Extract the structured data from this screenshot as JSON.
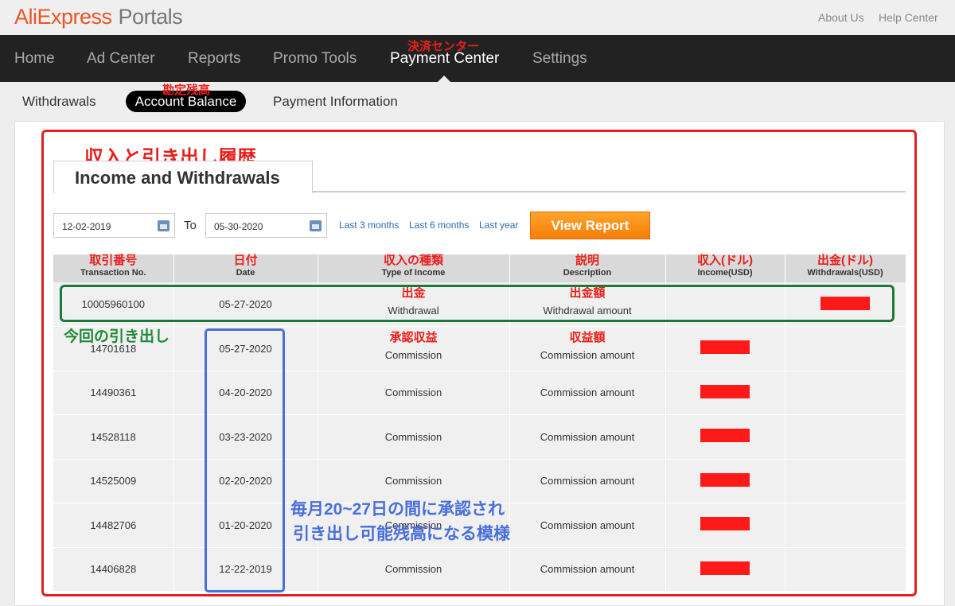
{
  "header": {
    "logo_brand": "AliExpress",
    "logo_product": "Portals",
    "links": [
      "About Us",
      "Help Center"
    ]
  },
  "nav": {
    "items": [
      "Home",
      "Ad Center",
      "Reports",
      "Promo Tools",
      "Payment Center",
      "Settings"
    ],
    "active": "Payment Center",
    "active_annotation": "決済センター"
  },
  "subnav": {
    "items": [
      "Withdrawals",
      "Account Balance",
      "Payment Information"
    ],
    "active": "Account Balance",
    "active_annotation": "勘定残高"
  },
  "section": {
    "annotation": "収入と引き出し履歴",
    "tab": "Income and Withdrawals"
  },
  "filters": {
    "from": "12-02-2019",
    "to_label": "To",
    "to": "05-30-2020",
    "quick": [
      "Last 3 months",
      "Last 6 months",
      "Last year"
    ],
    "view_report": "View Report"
  },
  "table": {
    "columns": [
      {
        "label": "Transaction No.",
        "annotation": "取引番号"
      },
      {
        "label": "Date",
        "annotation": "日付"
      },
      {
        "label": "Type of Income",
        "annotation": "収入の種類"
      },
      {
        "label": "Description",
        "annotation": "説明"
      },
      {
        "label": "Income(USD)",
        "annotation": "収入(ドル)"
      },
      {
        "label": "Withdrawals(USD)",
        "annotation": "出金(ドル)"
      }
    ],
    "rows": [
      {
        "no": "10005960100",
        "date": "05-27-2020",
        "type": "Withdrawal",
        "desc": "Withdrawal amount",
        "type_ann": "出金",
        "desc_ann": "出金額",
        "income_redacted": false,
        "withdrawal_redacted": true
      },
      {
        "no": "14701618",
        "date": "05-27-2020",
        "type": "Commission",
        "desc": "Commission amount",
        "type_ann": "承認収益",
        "desc_ann": "収益額",
        "income_redacted": true,
        "withdrawal_redacted": false
      },
      {
        "no": "14490361",
        "date": "04-20-2020",
        "type": "Commission",
        "desc": "Commission amount",
        "income_redacted": true,
        "withdrawal_redacted": false
      },
      {
        "no": "14528118",
        "date": "03-23-2020",
        "type": "Commission",
        "desc": "Commission amount",
        "income_redacted": true,
        "withdrawal_redacted": false
      },
      {
        "no": "14525009",
        "date": "02-20-2020",
        "type": "Commission",
        "desc": "Commission amount",
        "income_redacted": true,
        "withdrawal_redacted": false
      },
      {
        "no": "14482706",
        "date": "01-20-2020",
        "type": "Commission",
        "desc": "Commission amount",
        "income_redacted": true,
        "withdrawal_redacted": false
      },
      {
        "no": "14406828",
        "date": "12-22-2019",
        "type": "Commission",
        "desc": "Commission amount",
        "income_redacted": true,
        "withdrawal_redacted": false
      }
    ]
  },
  "annotations": {
    "current_withdrawal": "今回の引き出し",
    "approval_note_1": "毎月20~27日の間に承認され",
    "approval_note_2": "引き出し可能残高になる模様"
  },
  "colors": {
    "annotation_red": "#e8201c",
    "green": "#1f8a3a",
    "blue": "#4a6fd8",
    "button_orange": "#f58f1a",
    "nav_bg": "#222222",
    "redaction": "#ff1a1a"
  }
}
